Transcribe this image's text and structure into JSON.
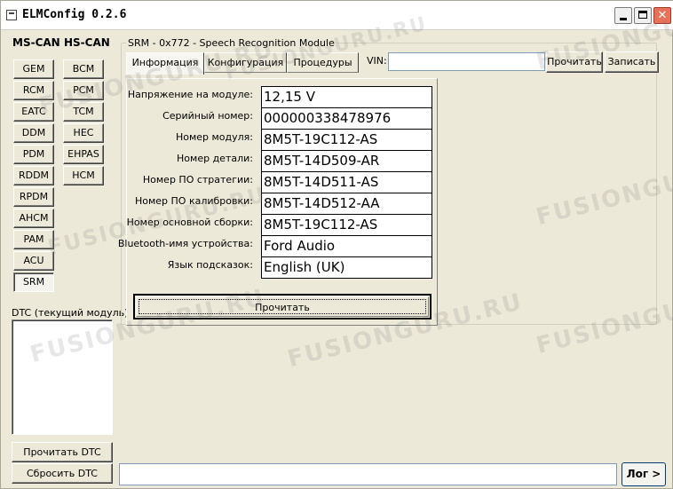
{
  "window": {
    "title": "ELMConfig 0.2.6",
    "close_glyph": "✕"
  },
  "sidebar": {
    "ms_can_label": "MS-CAN",
    "hs_can_label": "HS-CAN",
    "ms_can": [
      "GEM",
      "RCM",
      "EATC",
      "DDM",
      "PDM",
      "RDDM",
      "RPDM",
      "AHCM",
      "PAM",
      "ACU",
      "SRM"
    ],
    "hs_can": [
      "BCM",
      "PCM",
      "TCM",
      "HEC",
      "EHPAS",
      "HCM"
    ],
    "active_module": "SRM",
    "dtc_label": "DTC (текущий модуль):",
    "read_dtc": "Прочитать DTC",
    "reset_dtc": "Сбросить DTC"
  },
  "main": {
    "group_title": "SRM - 0x772 - Speech Recognition Module",
    "tabs": [
      "Информация",
      "Конфигурация",
      "Процедуры"
    ],
    "active_tab": "Информация",
    "vin_label": "VIN:",
    "vin_value": "",
    "read_button": "Прочитать",
    "write_button": "Записать",
    "fields": [
      {
        "label": "Напряжение на модуле:",
        "value": "12,15 V"
      },
      {
        "label": "Серийный номер:",
        "value": "000000338478976"
      },
      {
        "label": "Номер модуля:",
        "value": "8M5T-19C112-AS"
      },
      {
        "label": "Номер детали:",
        "value": "8M5T-14D509-AR"
      },
      {
        "label": "Номер ПО стратегии:",
        "value": "8M5T-14D511-AS"
      },
      {
        "label": "Номер ПО калибровки:",
        "value": "8M5T-14D512-AA"
      },
      {
        "label": "Номер основной сборки:",
        "value": "8M5T-19C112-AS"
      },
      {
        "label": "Bluetooth-имя устройства:",
        "value": "Ford Audio"
      },
      {
        "label": "Язык подсказок:",
        "value": "English (UK)"
      }
    ],
    "info_read_button": "Прочитать"
  },
  "footer": {
    "log_value": "",
    "log_button": "Лог >"
  },
  "watermarks": [
    "FUSIONGURU.RU",
    "FUSIONGURU.RU",
    "FUSIONGURU.RU",
    "FUSIONGURU.RU",
    "FUSIONGURU.RU",
    "FUSIONGURU.RU",
    "FUSIONGURU.RU",
    "FUSIONGURU.RU"
  ],
  "colors": {
    "window_bg": "#ece9d8",
    "input_border": "#7f9db9",
    "close_button": "#e8715a"
  }
}
